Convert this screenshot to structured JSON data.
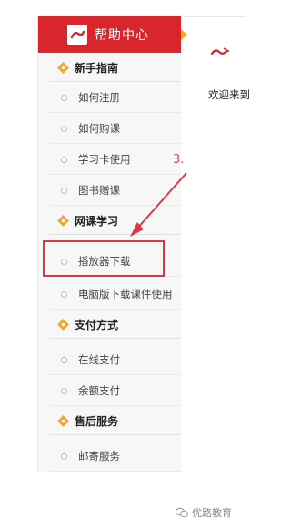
{
  "sidebar": {
    "title": "帮助中心",
    "sections": [
      {
        "label": "新手指南",
        "items": [
          "如何注册",
          "如何购课",
          "学习卡使用",
          "图书赠课"
        ]
      },
      {
        "label": "网课学习",
        "items": [
          "播放器下载",
          "电脑版下载课件使用"
        ]
      },
      {
        "label": "支付方式",
        "items": [
          "在线支付",
          "余额支付"
        ]
      },
      {
        "label": "售后服务",
        "items": [
          "邮寄服务"
        ]
      }
    ]
  },
  "main": {
    "welcome_text": "欢迎来到"
  },
  "annotation": {
    "step": "3."
  },
  "watermark": {
    "text": "优路教育"
  },
  "colors": {
    "accent": "#d9262c",
    "highlight": "#d83a45",
    "diamond": "#f0a830"
  },
  "icons": {
    "section": "diamond-icon",
    "item": "circle-bullet-icon"
  }
}
